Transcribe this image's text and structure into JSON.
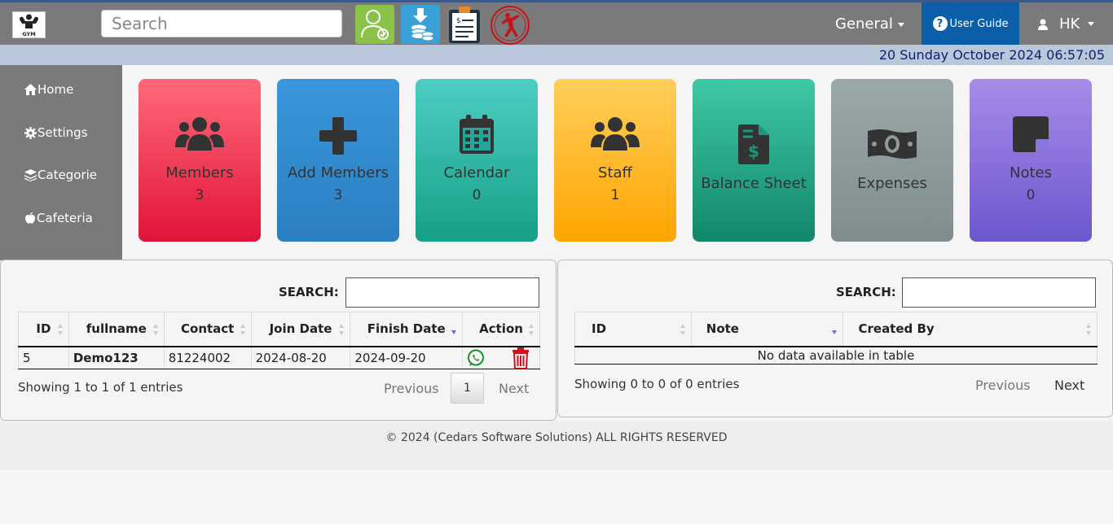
{
  "header": {
    "search_placeholder": "Search",
    "general_label": "General",
    "user_guide_label": "User Guide",
    "user_name": "HK",
    "date_time": "20 Sunday October 2024 06:57:05"
  },
  "sidebar": {
    "items": [
      {
        "label": "Home",
        "icon": "home-icon"
      },
      {
        "label": "Settings",
        "icon": "gear-icon"
      },
      {
        "label": "Categorie",
        "icon": "layers-icon"
      },
      {
        "label": "Cafeteria",
        "icon": "apple-icon"
      }
    ]
  },
  "tiles": [
    {
      "label": "Members",
      "count": "3",
      "icon": "users-icon",
      "color": "#ef2f4f"
    },
    {
      "label": "Add Members",
      "count": "3",
      "icon": "plus-icon",
      "color": "#3088cf"
    },
    {
      "label": "Calendar",
      "count": "0",
      "icon": "calendar-icon",
      "color": "#2fb6a6"
    },
    {
      "label": "Staff",
      "count": "1",
      "icon": "users-icon",
      "color": "#ffb82c"
    },
    {
      "label": "Balance Sheet",
      "icon": "invoice-dollar-icon",
      "color": "#27a685"
    },
    {
      "label": "Expenses",
      "icon": "money-bill-icon",
      "color": "#8e9b9b"
    },
    {
      "label": "Notes",
      "count": "0",
      "icon": "sticky-note-icon",
      "color": "#8870dc"
    }
  ],
  "members_table": {
    "search_label": "SEARCH:",
    "columns": [
      "ID",
      "fullname",
      "Contact",
      "Join Date",
      "Finish Date",
      "Action"
    ],
    "rows": [
      {
        "id": "5",
        "fullname": "Demo123",
        "contact": "81224002",
        "join_date": "2024-08-20",
        "finish_date": "2024-09-20"
      }
    ],
    "info": "Showing 1 to 1 of 1 entries",
    "previous": "Previous",
    "page": "1",
    "next": "Next"
  },
  "notes_table": {
    "search_label": "SEARCH:",
    "columns": [
      "ID",
      "Note",
      "Created By"
    ],
    "empty": "No data available in table",
    "info": "Showing 0 to 0 of 0 entries",
    "previous": "Previous",
    "next": "Next"
  },
  "footer": {
    "text": "© 2024 (Cedars Software Solutions) ALL RIGHTS RESERVED"
  }
}
